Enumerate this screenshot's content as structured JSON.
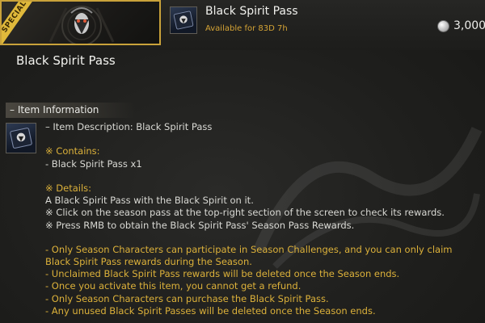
{
  "banner": {
    "ribbon_text": "SPECIAL"
  },
  "header": {
    "pass_title": "Black Spirit Pass",
    "availability": "Available for 83D 7h",
    "price": "3,000",
    "currency_icon": "silver-coin-icon"
  },
  "main": {
    "title": "Black Spirit Pass",
    "section_label": "– Item Information",
    "item_description": "– Item Description: Black Spirit Pass",
    "contains_label": "※ Contains:",
    "contains_items": [
      "- Black Spirit Pass x1"
    ],
    "details_label": "※ Details:",
    "details_lines": [
      "A Black Spirit Pass with the Black Spirit on it.",
      "※ Click on the season pass at the top-right section of the screen to check its rewards.",
      "※ Press RMB to obtain the Black Spirit Pass' Season Pass Rewards."
    ],
    "notes": [
      "- Only Season Characters can participate in Season Challenges, and you can only claim",
      "Black Spirit Pass rewards during the Season.",
      "- Unclaimed Black Spirit Pass rewards will be deleted once the Season ends.",
      "- Once you activate this item, you cannot get a refund.",
      "- Only Season Characters can purchase the Black Spirit Pass.",
      "- Any unused Black Spirit Passes will be deleted once the Season ends."
    ]
  },
  "colors": {
    "gold": "#dcb13a",
    "availability": "#d4a335",
    "text": "#d9d9d4",
    "background": "#1f1f1d",
    "banner_border": "#c9a23a"
  }
}
